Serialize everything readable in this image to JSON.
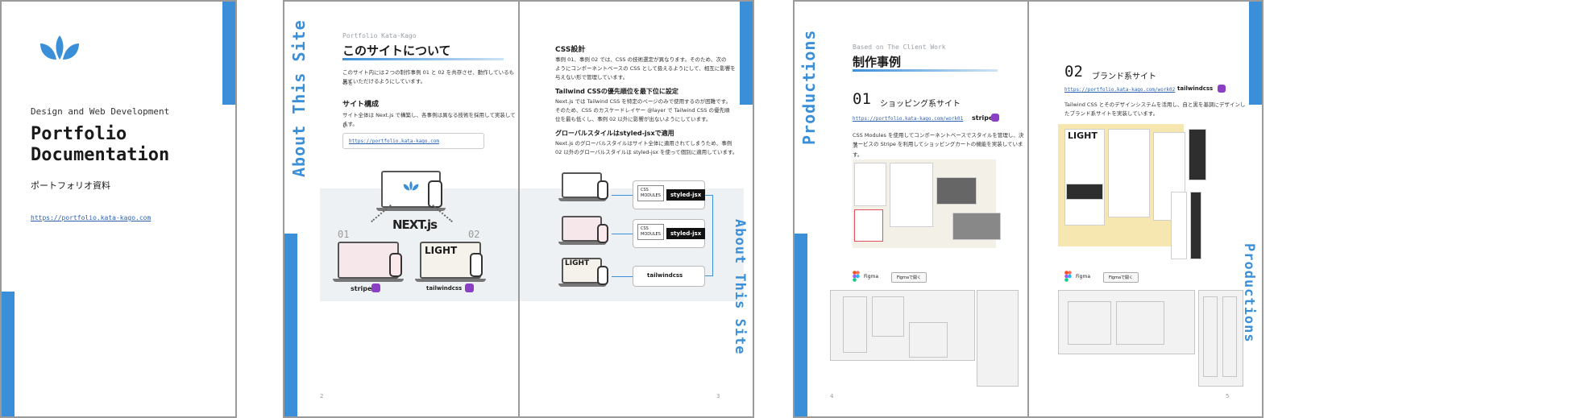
{
  "cover": {
    "subtitle": "Design and Web Development",
    "title_line1": "Portfolio",
    "title_line2": "Documentation",
    "japanese": "ポートフォリオ資料",
    "url": "https://portfolio.kata-kago.com"
  },
  "spread1": {
    "side_title": "About This Site",
    "kicker": "Portfolio Kata-Kago",
    "heading": "このサイトについて",
    "intro_1": "このサイト内には２つの制作事例 01 と 02 を共存させ、動作しているものを",
    "intro_2": "見ていただけるようにしています。",
    "section_heading": "サイト構成",
    "section_text_1": "サイト全体は Next.js で構築し、各事例は異なる技術を採用して実装してい",
    "section_text_2": "ます。",
    "link": "https://portfolio.kata-kago.com",
    "next_logo": "NEXT.js",
    "label_01": "01",
    "label_02": "02",
    "stripe": "stripe",
    "tailwind": "tailwindcss",
    "light": "LIGHT",
    "page_left": "2",
    "page_right": "3",
    "css_heading": "CSS設計",
    "css_text_1": "事例 01、事例 02 では、CSS の技術選定が異なります。そのため、次の",
    "css_text_2": "ようにコンポーネントベースの CSS として扱えるようにして、相互に影響を",
    "css_text_3": "与えない形で管理しています。",
    "tw_heading": "Tailwind CSSの優先順位を最下位に設定",
    "tw_text_1": "Next.js では Tailwind CSS を特定のページのみで使用するのが困難です。",
    "tw_text_2": "そのため、CSS のカスケードレイヤー @layer で Tailwind CSS の優先順",
    "tw_text_3": "位を最も低くし、事例 02 以外に影響が出ないようにしています。",
    "global_heading": "グローバルスタイルはstyled-jsxで適用",
    "global_text_1": "Next.js のグローバルスタイルはサイト全体に適用されてしまうため、事例",
    "global_text_2": "02 以外のグローバルスタイルは styled-jsx を使って個別に適用しています。",
    "css_modules": "CSS\nMODULES",
    "styled_jsx": "styled-jsx",
    "right_side_title": "About This Site"
  },
  "spread2": {
    "side_title": "Productions",
    "kicker": "Based on The Client Work",
    "heading": "制作事例",
    "num_01": "01",
    "title_01": "ショッピング系サイト",
    "link_01": "https://portfolio.kata-kago.com/work01",
    "desc_01_1": "CSS Modules を使用してコンポーネントベースでスタイルを管理し、決済",
    "desc_01_2": "サービスの Stripe を利用してショッピングカートの機能を実装しています。",
    "num_02": "02",
    "title_02": "ブランド系サイト",
    "link_02": "https://portfolio.kata-kago.com/work02",
    "desc_02_1": "Tailwind CSS とそのデザインシステムを活用し、自と黒を基調にデザインし",
    "desc_02_2": "たブランド系サイトを実装しています。",
    "figma": "Figma",
    "figma_button": "Figmaで開く",
    "stripe": "stripe",
    "tailwind": "tailwindcss",
    "light": "LIGHT",
    "page_left": "4",
    "page_right": "5",
    "right_side_title": "Productions"
  },
  "colors": {
    "accent": "#3b8fd8",
    "border": "#9a9a9a"
  }
}
